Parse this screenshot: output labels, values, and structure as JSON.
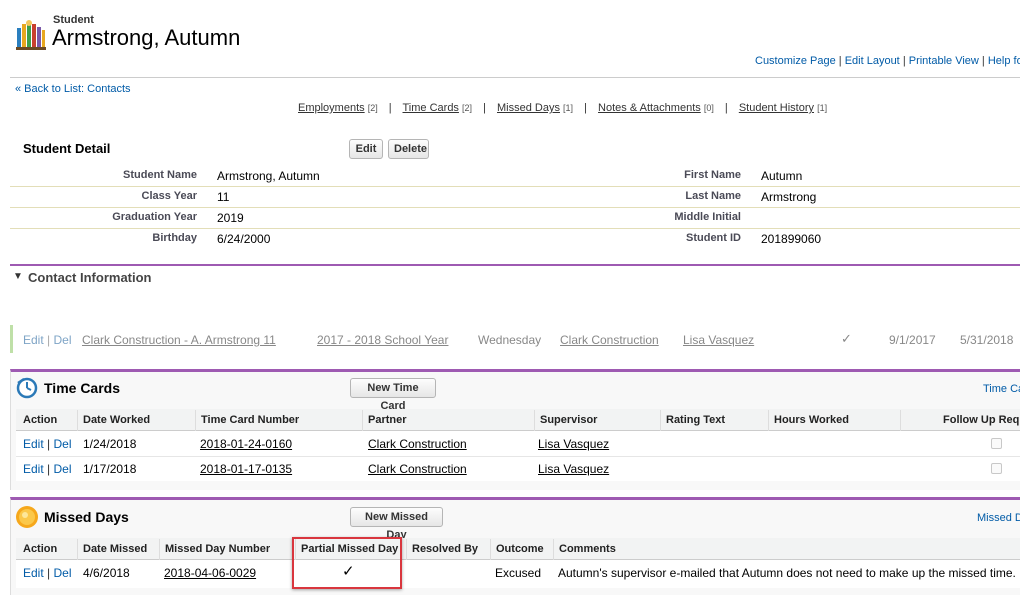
{
  "header": {
    "object_type": "Student",
    "record_name": "Armstrong, Autumn"
  },
  "top_links": {
    "customize_page": "Customize Page",
    "edit_layout": "Edit Layout",
    "printable_view": "Printable View",
    "help": "Help fo",
    "sep": "|"
  },
  "back_link": "« Back to List: Contacts",
  "related_links": [
    {
      "label": "Employments",
      "count": "[2]"
    },
    {
      "label": "Time Cards",
      "count": "[2]"
    },
    {
      "label": "Missed Days",
      "count": "[1]"
    },
    {
      "label": "Notes & Attachments",
      "count": "[0]"
    },
    {
      "label": "Student History",
      "count": "[1]"
    }
  ],
  "related_sep": "|",
  "detail": {
    "title": "Student Detail",
    "edit_label": "Edit",
    "delete_label": "Delete",
    "left_labels": [
      "Student Name",
      "Class Year",
      "Graduation Year",
      "Birthday"
    ],
    "left_values": [
      "Armstrong, Autumn",
      "11",
      "2019",
      "6/24/2000"
    ],
    "right_labels": [
      "First Name",
      "Last Name",
      "Middle Initial",
      "Student ID"
    ],
    "right_values": [
      "Autumn",
      "Armstrong",
      "",
      "201899060"
    ]
  },
  "contact_info": {
    "toggle": "▼",
    "title": "Contact Information"
  },
  "employment_row": {
    "edit": "Edit",
    "sep": "|",
    "del": "Del",
    "name": "Clark Construction - A. Armstrong 11",
    "school_year": "2017 - 2018 School Year",
    "day": "Wednesday",
    "partner": "Clark Construction",
    "supervisor": "Lisa Vasquez",
    "check": "✓",
    "start": "9/1/2017",
    "end": "5/31/2018"
  },
  "time_cards": {
    "title": "Time Cards",
    "new_button": "New Time Card",
    "help_link": "Time Ca",
    "headers": [
      "Action",
      "Date Worked",
      "Time Card Number",
      "Partner",
      "Supervisor",
      "Rating Text",
      "Hours Worked",
      "Follow Up Requ"
    ],
    "rows": [
      {
        "edit": "Edit",
        "sep": "|",
        "del": "Del",
        "date": "1/24/2018",
        "number": "2018-01-24-0160",
        "partner": "Clark Construction",
        "supervisor": "Lisa Vasquez"
      },
      {
        "edit": "Edit",
        "sep": "|",
        "del": "Del",
        "date": "1/17/2018",
        "number": "2018-01-17-0135",
        "partner": "Clark Construction",
        "supervisor": "Lisa Vasquez"
      }
    ]
  },
  "missed_days": {
    "title": "Missed Days",
    "new_button": "New Missed Day",
    "help_link": "Missed D",
    "headers": [
      "Action",
      "Date Missed",
      "Missed Day Number",
      "Partial Missed Day",
      "Resolved By",
      "Outcome",
      "Comments"
    ],
    "rows": [
      {
        "edit": "Edit",
        "sep": "|",
        "del": "Del",
        "date": "4/6/2018",
        "number": "2018-04-06-0029",
        "partial": "✓",
        "resolved_by": "",
        "outcome": "Excused",
        "comments": "Autumn's supervisor e-mailed that Autumn does not need to make up the missed time."
      }
    ]
  },
  "colors": {
    "link": "#015ba7",
    "accent_purple": "#9e5ab2",
    "highlight_red": "#d9363e"
  }
}
